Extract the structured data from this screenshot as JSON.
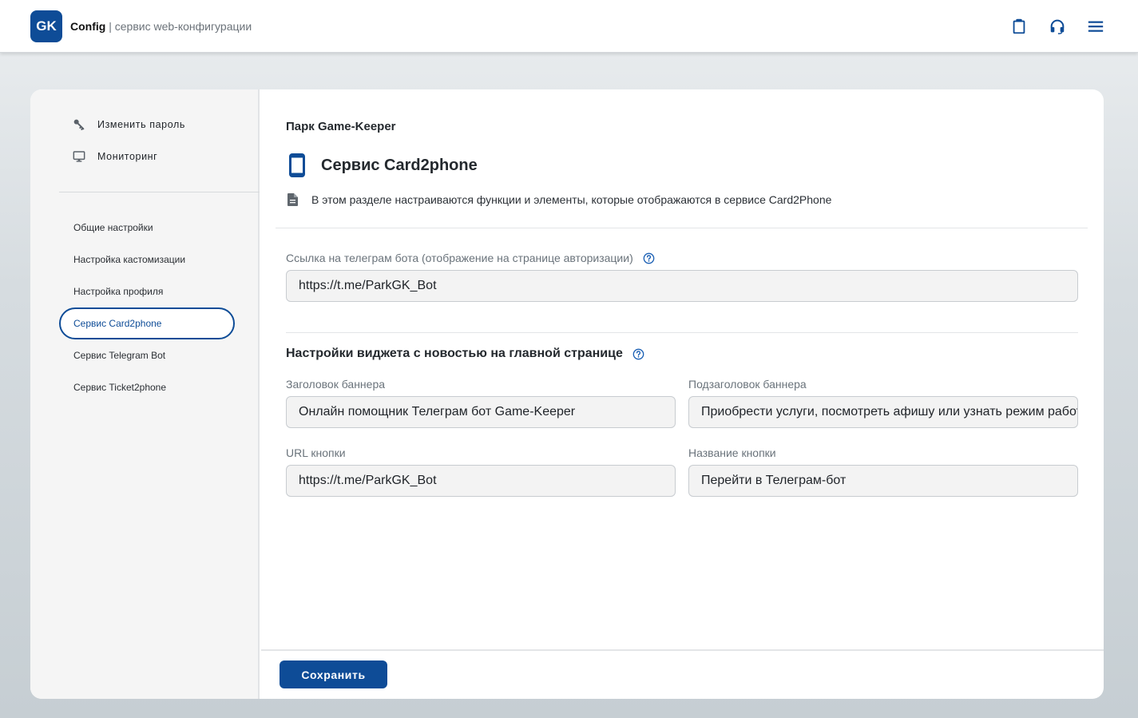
{
  "header": {
    "logo_text": "GK",
    "app_name": "Config",
    "separator": " | ",
    "app_subtitle": "сервис web-конфигурации",
    "icons": [
      "clipboard-icon",
      "headset-icon",
      "menu-icon"
    ]
  },
  "sidebar": {
    "top_items": [
      {
        "label": "Изменить пароль",
        "icon": "key-icon"
      },
      {
        "label": "Мониторинг",
        "icon": "monitor-icon"
      }
    ],
    "nav_items": [
      {
        "label": "Общие настройки"
      },
      {
        "label": "Настройка кастомизации"
      },
      {
        "label": "Настройка профиля"
      },
      {
        "label": "Сервис Card2phone",
        "active": true
      },
      {
        "label": "Сервис Telegram Bot"
      },
      {
        "label": "Сервис Ticket2phone"
      }
    ]
  },
  "main": {
    "park_title": "Парк Game-Keeper",
    "service_title": "Сервис Card2phone",
    "description": "В этом разделе настраиваются функции и элементы, которые отображаются в сервисе Card2Phone",
    "telegram_link": {
      "label": "Ссылка на телеграм бота (отображение на странице авторизации)",
      "value": "https://t.me/ParkGK_Bot"
    },
    "widget_section": {
      "title": "Настройки виджета с новостью на главной странице",
      "banner_title": {
        "label": "Заголовок баннера",
        "value": "Онлайн помощник Телеграм бот Game-Keeper"
      },
      "banner_subtitle": {
        "label": "Подзаголовок баннера",
        "value": "Приобрести услуги, посмотреть афишу или узнать режим работы"
      },
      "button_url": {
        "label": "URL кнопки",
        "value": "https://t.me/ParkGK_Bot"
      },
      "button_name": {
        "label": "Название кнопки",
        "value": "Перейти в Телеграм-бот"
      }
    },
    "save_label": "Сохранить"
  },
  "colors": {
    "accent": "#0e4c97",
    "help_icon": "#1a5fb4"
  }
}
